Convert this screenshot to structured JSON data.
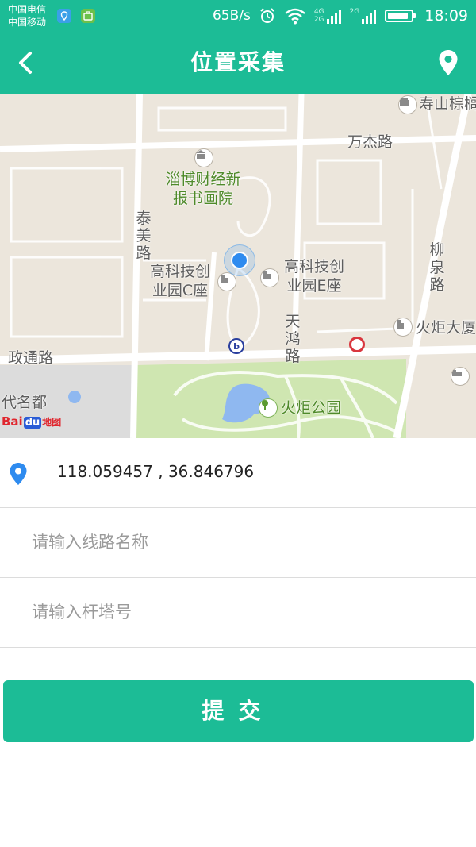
{
  "status_bar": {
    "carrier_1": "中国电信",
    "carrier_2": "中国移动",
    "net_speed": "65B/s",
    "network_4g": "4G",
    "network_2g_a": "2G",
    "network_2g_b": "2G",
    "time": "18:09",
    "battery_level": 0.9
  },
  "header": {
    "title": "位置采集",
    "back_icon": "chevron-left-icon",
    "location_icon": "map-pin-icon"
  },
  "map": {
    "labels": {
      "shoushan": "寿山棕榈",
      "wanjie_road": "万杰路",
      "zibo_school": "淄博财经新报书画院",
      "taimei_road": "泰美路",
      "liuquan_road": "柳泉路",
      "park_c": "高科技创业园C座",
      "park_e": "高科技创业园E座",
      "tianhong_road": "天鸿路",
      "huoju_tower": "火炬大厦",
      "zhengtong_road": "政通路",
      "dai_mingdu": "代名都",
      "huoju_park": "火炬公园"
    },
    "logo": {
      "bai": "Bai",
      "du": "du",
      "ditu": "地图"
    }
  },
  "form": {
    "coordinates": "118.059457 , 36.846796",
    "line_name_placeholder": "请输入线路名称",
    "tower_number_placeholder": "请输入杆塔号",
    "submit_label": "提交"
  },
  "colors": {
    "primary": "#1cbc96",
    "pin_blue": "#2e8bef",
    "map_bg": "#ece6dc",
    "park_green": "#cfe6b1",
    "water": "#8fb8f0"
  }
}
